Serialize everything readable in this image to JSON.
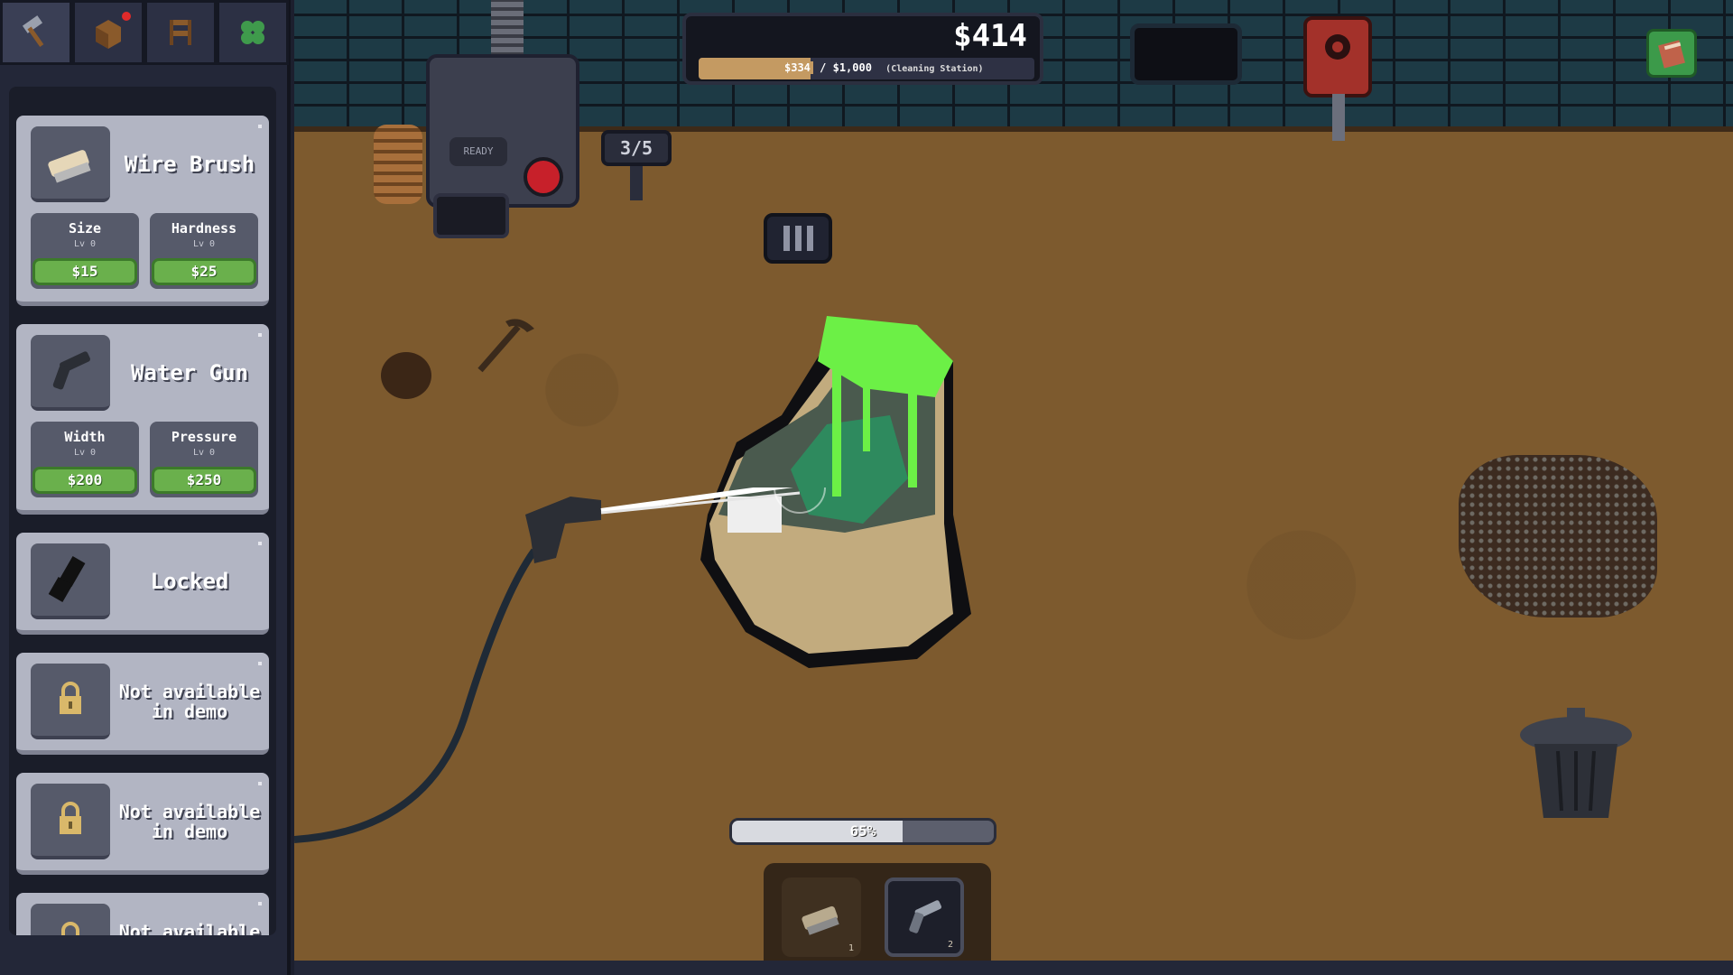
{
  "top_tabs": [
    {
      "icon": "hammer-icon"
    },
    {
      "icon": "crate-icon",
      "notification": true
    },
    {
      "icon": "bench-icon"
    },
    {
      "icon": "clover-icon"
    }
  ],
  "tools": [
    {
      "name": "Wire Brush",
      "icon": "wire-brush-icon",
      "upgrades": [
        {
          "label": "Size",
          "level": "Lv 0",
          "price": "$15"
        },
        {
          "label": "Hardness",
          "level": "Lv 0",
          "price": "$25"
        }
      ]
    },
    {
      "name": "Water Gun",
      "icon": "water-gun-icon",
      "upgrades": [
        {
          "label": "Width",
          "level": "Lv 0",
          "price": "$200"
        },
        {
          "label": "Pressure",
          "level": "Lv 0",
          "price": "$250"
        }
      ]
    },
    {
      "name": "Locked",
      "icon": "locked-tool-icon"
    },
    {
      "name": "Not available in demo",
      "icon": "padlock-icon"
    },
    {
      "name": "Not available in demo",
      "icon": "padlock-icon"
    },
    {
      "name": "Not available in",
      "icon": "padlock-icon"
    }
  ],
  "money": {
    "total": "$414",
    "progress_current": "$334",
    "progress_target": "/ $1,000",
    "progress_destination": "(Cleaning Station)",
    "progress_fraction": 0.334
  },
  "machine": {
    "status": "READY"
  },
  "counter": "3/5",
  "cleaning": {
    "percent_label": "65%",
    "fraction": 0.65
  },
  "hotbar": [
    {
      "icon": "wire-brush-icon",
      "key": "1"
    },
    {
      "icon": "water-gun-icon",
      "key": "2",
      "active": true
    }
  ],
  "colors": {
    "price_button": "#6ab04c",
    "slime": "#6cf046",
    "money_bar": "#c49a62",
    "floor": "#7d5a2e"
  }
}
